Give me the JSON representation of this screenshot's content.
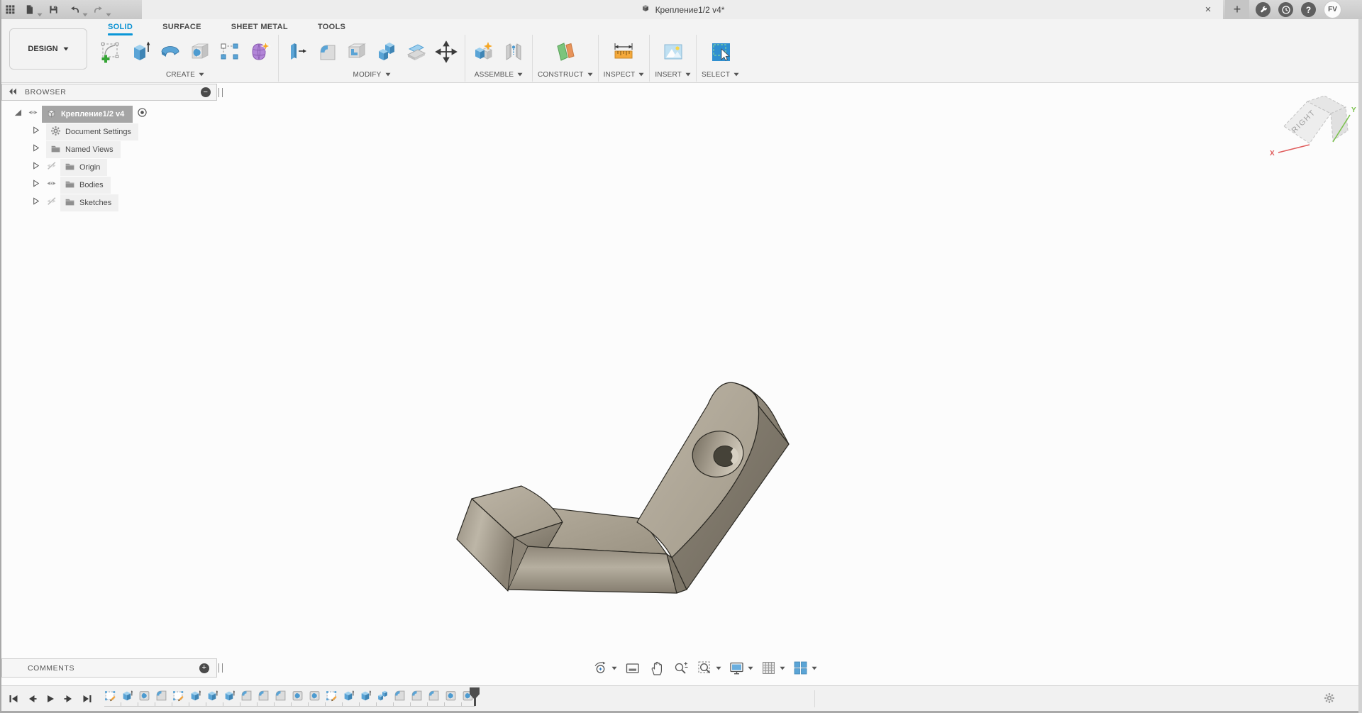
{
  "titlebar": {
    "title": "Крепление1/2 v4*",
    "close_glyph": "×",
    "new_tab_glyph": "+",
    "help_glyph": "?",
    "avatar": "FV",
    "left_icons": [
      "app-grid",
      "file-new",
      "save",
      "undo",
      "redo"
    ],
    "right_icons": [
      "job-status",
      "notifications",
      "help"
    ]
  },
  "ribbon": {
    "environment": "DESIGN",
    "tabs": [
      {
        "label": "SOLID",
        "active": true
      },
      {
        "label": "SURFACE",
        "active": false
      },
      {
        "label": "SHEET METAL",
        "active": false
      },
      {
        "label": "TOOLS",
        "active": false
      }
    ],
    "groups": [
      {
        "label": "CREATE",
        "icons": [
          "create-sketch",
          "extrude",
          "revolve",
          "hole",
          "rectangular-pattern",
          "create-form"
        ]
      },
      {
        "label": "MODIFY",
        "icons": [
          "press-pull",
          "fillet",
          "shell",
          "combine",
          "split-body",
          "move"
        ]
      },
      {
        "label": "ASSEMBLE",
        "icons": [
          "new-component",
          "joint"
        ]
      },
      {
        "label": "CONSTRUCT",
        "icons": [
          "construction-plane"
        ]
      },
      {
        "label": "INSPECT",
        "icons": [
          "measure"
        ]
      },
      {
        "label": "INSERT",
        "icons": [
          "insert-image"
        ]
      },
      {
        "label": "SELECT",
        "icons": [
          "select"
        ]
      }
    ]
  },
  "browser": {
    "header": "BROWSER",
    "root": {
      "label": "Крепление1/2 v4",
      "visibility": "visible",
      "selected": true
    },
    "items": [
      {
        "label": "Document Settings",
        "icon": "gear",
        "visibility": "none"
      },
      {
        "label": "Named Views",
        "icon": "folder",
        "visibility": "none"
      },
      {
        "label": "Origin",
        "icon": "folder",
        "visibility": "hidden"
      },
      {
        "label": "Bodies",
        "icon": "folder",
        "visibility": "visible"
      },
      {
        "label": "Sketches",
        "icon": "folder",
        "visibility": "hidden"
      }
    ]
  },
  "viewcube": {
    "face_label": "RIGHT",
    "axis_x": "X",
    "axis_y": "Y"
  },
  "comments": {
    "label": "COMMENTS"
  },
  "navbar": {
    "items": [
      {
        "name": "orbit",
        "dropdown": true
      },
      {
        "name": "look-at",
        "dropdown": false
      },
      {
        "name": "pan",
        "dropdown": false
      },
      {
        "name": "zoom",
        "dropdown": false
      },
      {
        "name": "fit",
        "dropdown": true
      },
      {
        "name": "display-settings",
        "dropdown": true
      },
      {
        "name": "grid",
        "dropdown": true
      },
      {
        "name": "viewports",
        "dropdown": true
      }
    ]
  },
  "timeline": {
    "playback": [
      "go-to-start",
      "step-back",
      "play",
      "step-forward",
      "go-to-end"
    ],
    "features": [
      "sketch",
      "extrude",
      "hole",
      "fillet",
      "sketch",
      "extrude",
      "extrude",
      "extrude",
      "fillet",
      "fillet",
      "fillet",
      "hole",
      "hole",
      "sketch",
      "extrude",
      "extrude",
      "combine",
      "fillet",
      "fillet",
      "fillet",
      "hole",
      "hole"
    ]
  },
  "colors": {
    "accent": "#0a96d7",
    "icon_blue": "#5aa4d6",
    "model_tan": "#aaa294"
  }
}
